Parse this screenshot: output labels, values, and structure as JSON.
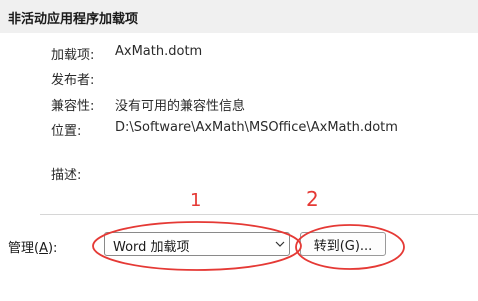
{
  "section": {
    "title": "非活动应用程序加载项"
  },
  "details": [
    {
      "label": "加载项:",
      "value": "AxMath.dotm"
    },
    {
      "label": "发布者:",
      "value": ""
    },
    {
      "label": "兼容性:",
      "value": "没有可用的兼容性信息"
    },
    {
      "label": "位置:",
      "value": "D:\\Software\\AxMath\\MSOffice\\AxMath.dotm"
    },
    {
      "label": "描述:",
      "value": ""
    }
  ],
  "manage": {
    "label_prefix": "管理(",
    "label_accel": "A",
    "label_suffix": "):",
    "selected": "Word 加载项",
    "chevron_icon": "chevron-down-icon"
  },
  "go_button": {
    "label": "转到(G)..."
  },
  "annotations": {
    "color": "#e53935",
    "mark_1": "1",
    "mark_2": "2"
  }
}
